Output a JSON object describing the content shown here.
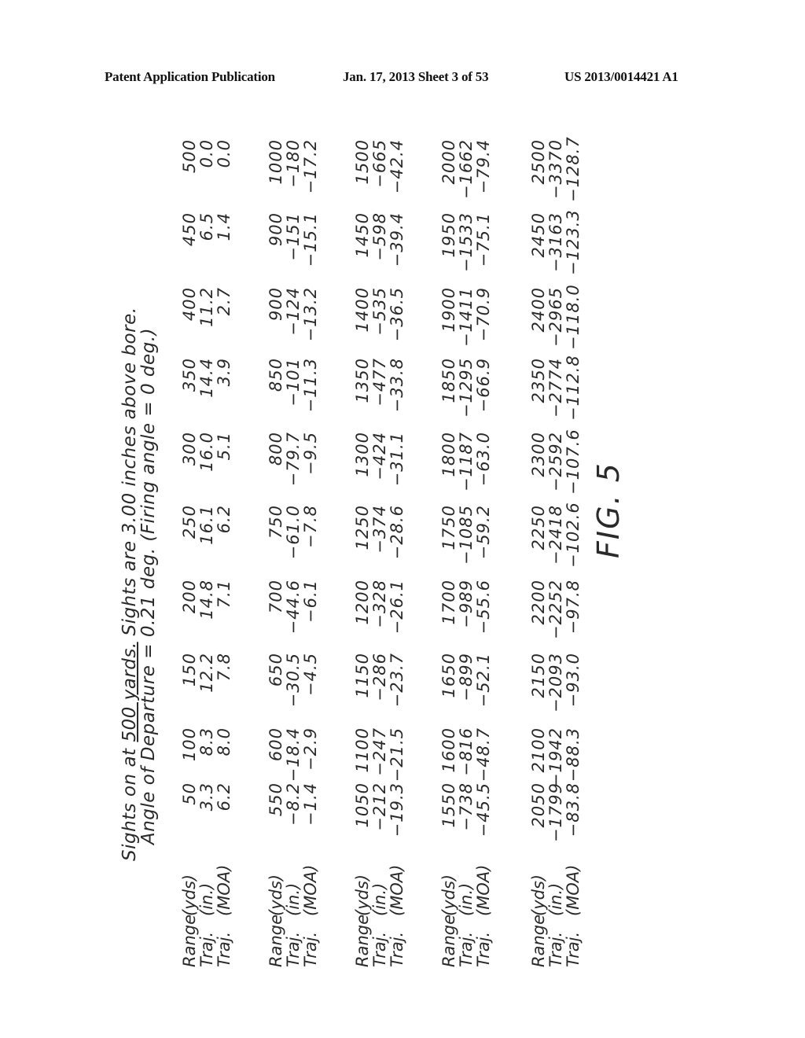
{
  "header": {
    "publication": "Patent Application Publication",
    "date_sheet": "Jan. 17, 2013  Sheet 3 of 53",
    "number": "US 2013/0014421 A1"
  },
  "title": {
    "line1_prefix": "Sights on at ",
    "line1_underlined": "500 yards.",
    "line1_suffix": " Sights are 3.00 inches above bore.",
    "line2": "Angle of Departure = 0.21 deg. (Firing angle = 0 deg.)"
  },
  "row_labels": [
    "Range",
    "Traj.",
    "Traj."
  ],
  "row_units": [
    "(yds)",
    "(in.)",
    "(MOA)"
  ],
  "figure_label": "FIG. 5",
  "blocks": [
    {
      "range": [
        "50",
        "100",
        "150",
        "200",
        "250",
        "300",
        "350",
        "400",
        "450",
        "500"
      ],
      "traj_in": [
        "3.3",
        "8.3",
        "12.2",
        "14.8",
        "16.1",
        "16.0",
        "14.4",
        "11.2",
        "6.5",
        "0.0"
      ],
      "traj_moa": [
        "6.2",
        "8.0",
        "7.8",
        "7.1",
        "6.2",
        "5.1",
        "3.9",
        "2.7",
        "1.4",
        "0.0"
      ]
    },
    {
      "range": [
        "550",
        "600",
        "650",
        "700",
        "750",
        "800",
        "850",
        "900",
        "900",
        "1000"
      ],
      "traj_in": [
        "-8.2",
        "-18.4",
        "-30.5",
        "-44.6",
        "-61.0",
        "-79.7",
        "-101",
        "-124",
        "-151",
        "-180"
      ],
      "traj_moa": [
        "-1.4",
        "-2.9",
        "-4.5",
        "-6.1",
        "-7.8",
        "-9.5",
        "-11.3",
        "-13.2",
        "-15.1",
        "-17.2"
      ]
    },
    {
      "range": [
        "1050",
        "1100",
        "1150",
        "1200",
        "1250",
        "1300",
        "1350",
        "1400",
        "1450",
        "1500"
      ],
      "traj_in": [
        "-212",
        "-247",
        "-286",
        "-328",
        "-374",
        "-424",
        "-477",
        "-535",
        "-598",
        "-665"
      ],
      "traj_moa": [
        "-19.3",
        "-21.5",
        "-23.7",
        "-26.1",
        "-28.6",
        "-31.1",
        "-33.8",
        "-36.5",
        "-39.4",
        "-42.4"
      ]
    },
    {
      "range": [
        "1550",
        "1600",
        "1650",
        "1700",
        "1750",
        "1800",
        "1850",
        "1900",
        "1950",
        "2000"
      ],
      "traj_in": [
        "-738",
        "-816",
        "-899",
        "-989",
        "-1085",
        "-1187",
        "-1295",
        "-1411",
        "-1533",
        "-1662"
      ],
      "traj_moa": [
        "-45.5",
        "-48.7",
        "-52.1",
        "-55.6",
        "-59.2",
        "-63.0",
        "-66.9",
        "-70.9",
        "-75.1",
        "-79.4"
      ]
    },
    {
      "range": [
        "2050",
        "2100",
        "2150",
        "2200",
        "2250",
        "2300",
        "2350",
        "2400",
        "2450",
        "2500"
      ],
      "traj_in": [
        "-1799",
        "-1942",
        "-2093",
        "-2252",
        "-2418",
        "-2592",
        "-2774",
        "-2965",
        "-3163",
        "-3370"
      ],
      "traj_moa": [
        "-83.8",
        "-88.3",
        "-93.0",
        "-97.8",
        "-102.6",
        "-107.6",
        "-112.8",
        "-118.0",
        "-123.3",
        "-128.7"
      ]
    }
  ]
}
